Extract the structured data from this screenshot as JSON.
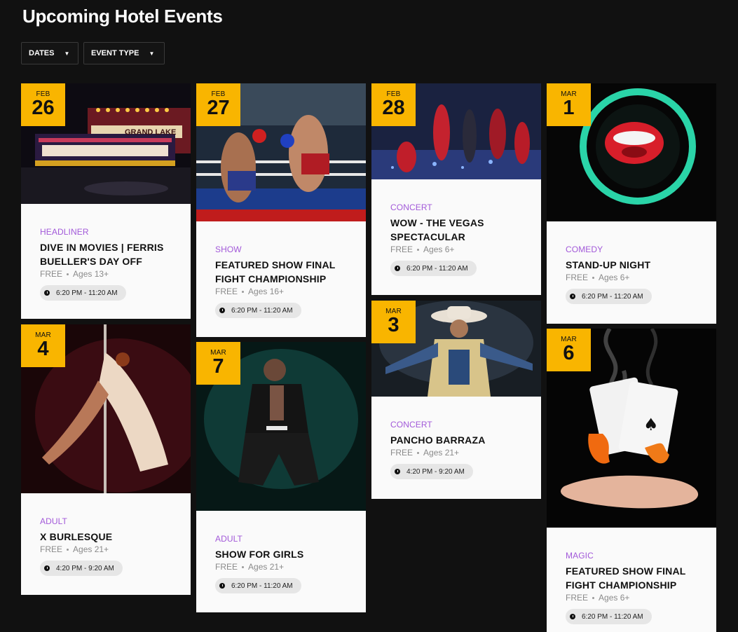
{
  "page": {
    "title": "Upcoming Hotel Events"
  },
  "filters": [
    {
      "label": "DATES"
    },
    {
      "label": "EVENT TYPE"
    }
  ],
  "events": [
    {
      "month": "FEB",
      "day": "26",
      "category": "HEADLINER",
      "title_lines": [
        "DIVE IN MOVIES | FERRIS",
        "BUELLER'S DAY OFF"
      ],
      "price": "FREE",
      "ages": "Ages 13+",
      "time": "6:20 PM - 11:20 AM",
      "image": "grand-lake-theater-marquee",
      "marquee": "GRAND LAKE"
    },
    {
      "month": "FEB",
      "day": "27",
      "category": "SHOW",
      "title_lines": [
        "FEATURED SHOW FINAL",
        "FIGHT CHAMPIONSHIP"
      ],
      "price": "FREE",
      "ages": "Ages 16+",
      "time": "6:20 PM - 11:20 AM",
      "image": "kickboxing-match"
    },
    {
      "month": "FEB",
      "day": "28",
      "category": "CONCERT",
      "title_lines": [
        "WOW - THE VEGAS",
        "SPECTACULAR"
      ],
      "price": "FREE",
      "ages": "Ages 6+",
      "time": "6:20 PM - 11:20 AM",
      "image": "dancers-on-stage"
    },
    {
      "month": "MAR",
      "day": "1",
      "category": "COMEDY",
      "title_lines": [
        "STAND-UP NIGHT"
      ],
      "price": "FREE",
      "ages": "Ages 6+",
      "time": "6:20 PM - 11:20 AM",
      "image": "comedy-store-neon-sign"
    },
    {
      "month": "MAR",
      "day": "4",
      "category": "ADULT",
      "title_lines": [
        "X BURLESQUE"
      ],
      "price": "FREE",
      "ages": "Ages 21+",
      "time": "4:20 PM - 9:20 AM",
      "image": "pole-dancer"
    },
    {
      "month": "MAR",
      "day": "7",
      "category": "ADULT",
      "title_lines": [
        "SHOW FOR GIRLS"
      ],
      "price": "FREE",
      "ages": "Ages 21+",
      "time": "6:20 PM - 11:20 AM",
      "image": "male-dancer-leather-jacket"
    },
    {
      "month": "MAR",
      "day": "3",
      "category": "CONCERT",
      "title_lines": [
        "PANCHO BARRAZA"
      ],
      "price": "FREE",
      "ages": "Ages 21+",
      "time": "4:20 PM - 9:20 AM",
      "image": "cowboy-singer"
    },
    {
      "month": "MAR",
      "day": "6",
      "category": "MAGIC",
      "title_lines": [
        "FEATURED SHOW FINAL",
        "FIGHT CHAMPIONSHIP"
      ],
      "price": "FREE",
      "ages": "Ages 6+",
      "time": "6:20 PM - 11:20 AM",
      "image": "burning-playing-cards"
    }
  ]
}
